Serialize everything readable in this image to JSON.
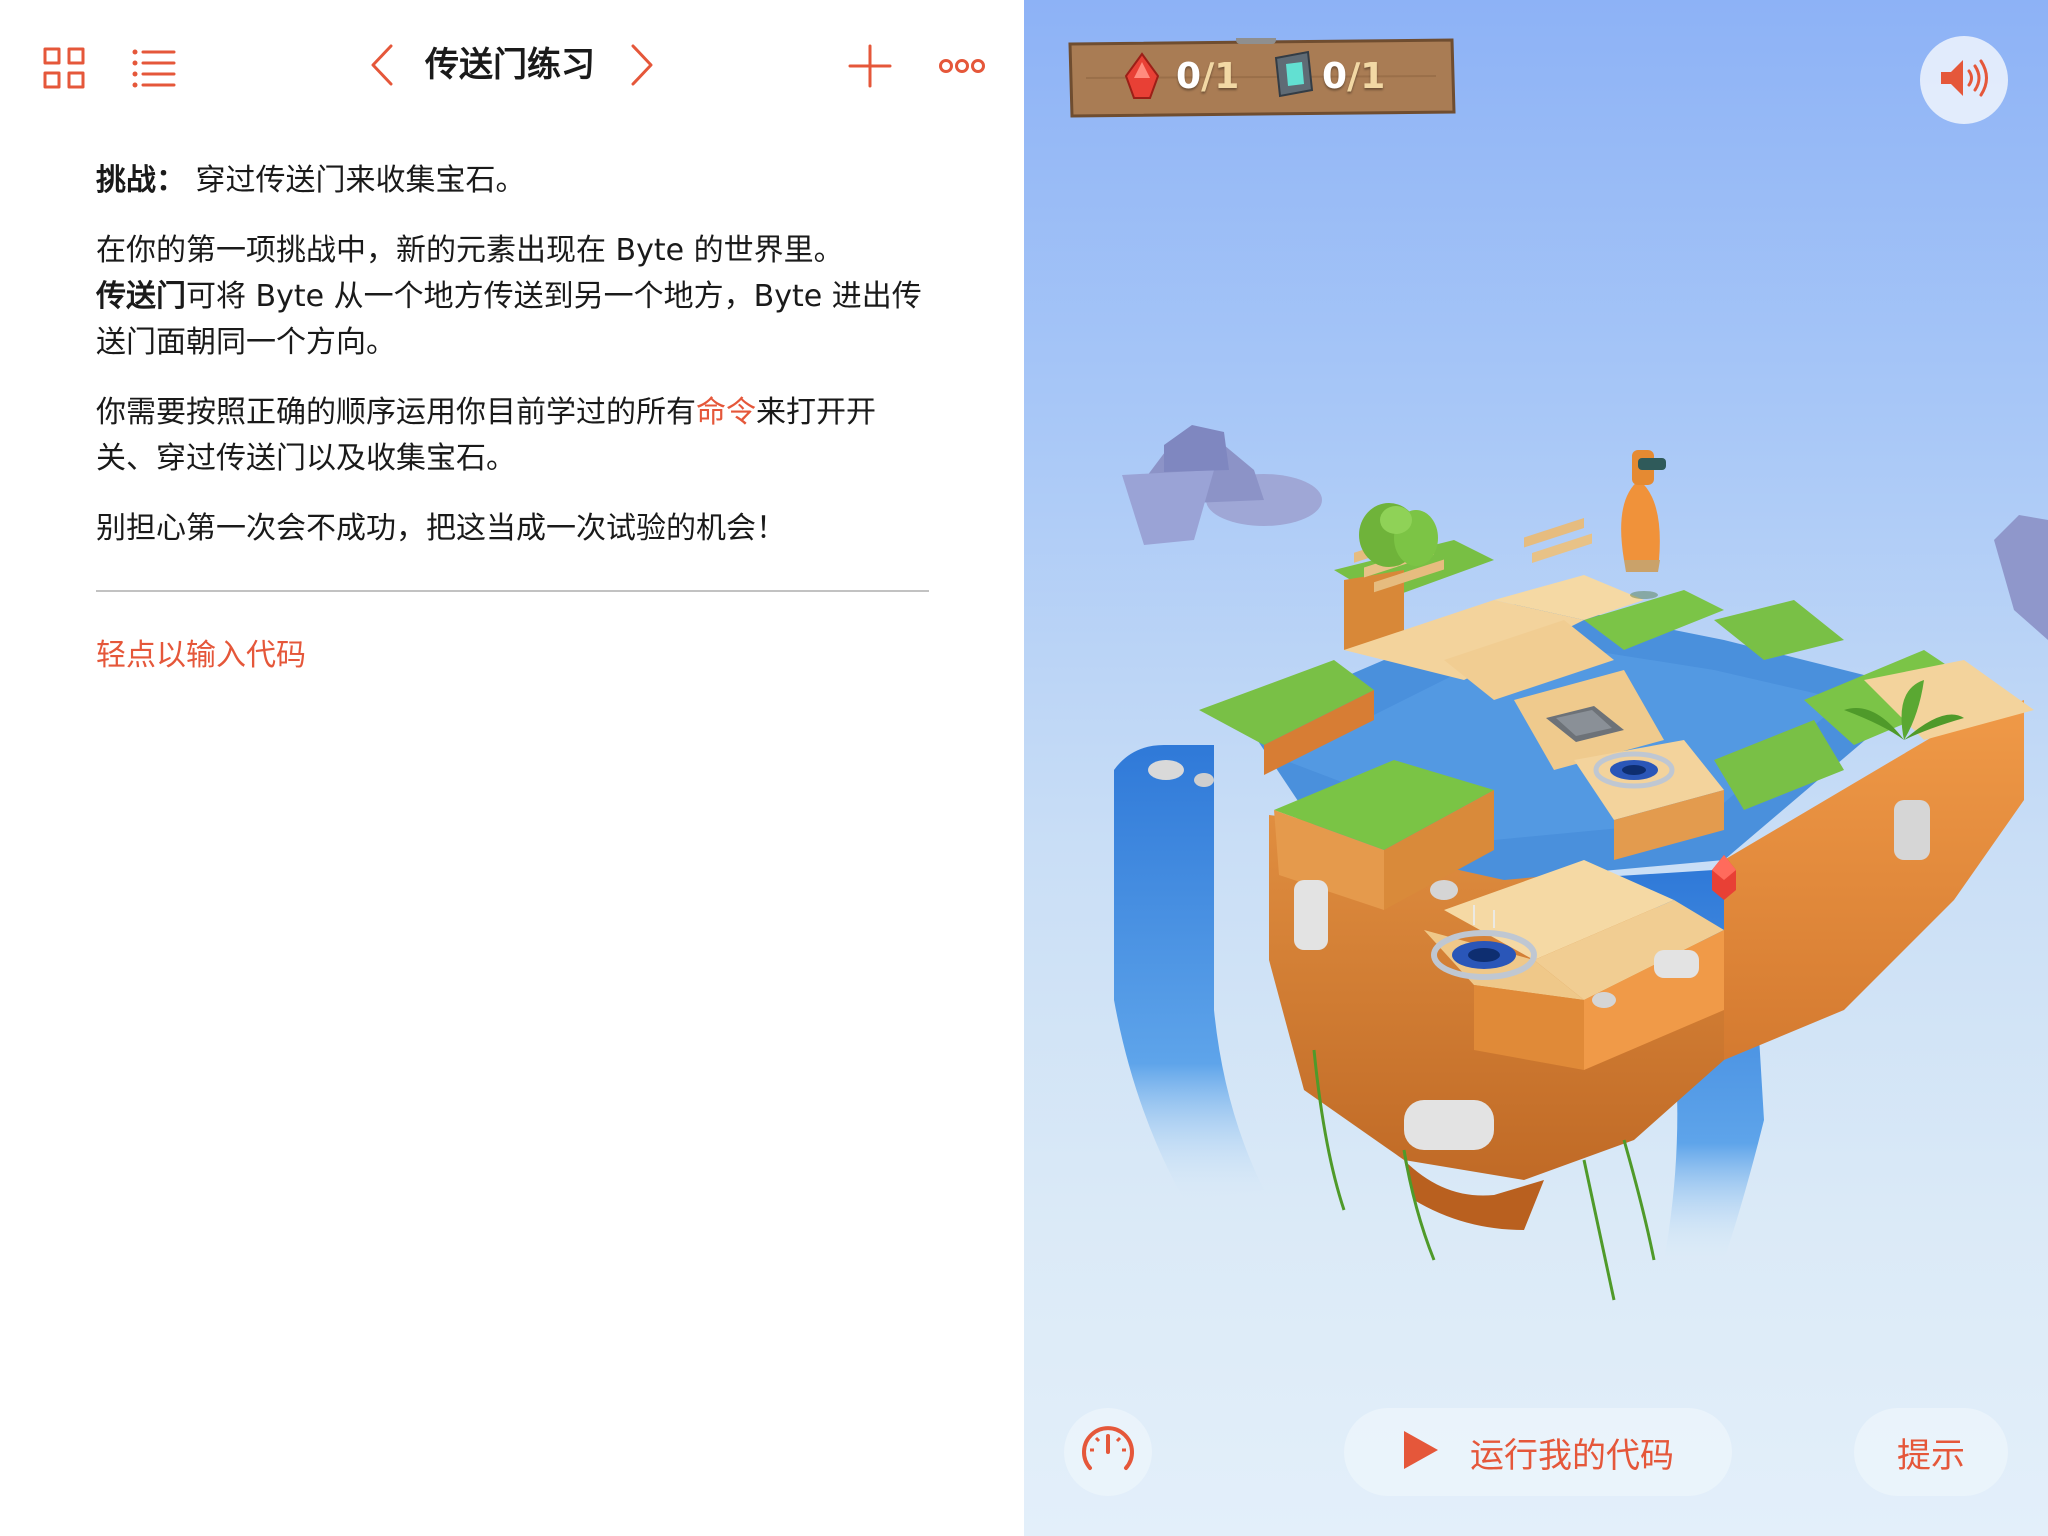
{
  "toolbar": {
    "title": "传送门练习",
    "icons": [
      "grid-icon",
      "list-icon",
      "chevron-left-icon",
      "chevron-right-icon",
      "plus-icon",
      "more-icon"
    ]
  },
  "content": {
    "challenge_label": "挑战：",
    "challenge_text": " 穿过传送门来收集宝石。",
    "para1": "在你的第一项挑战中，新的元素出现在  Byte  的世界里。",
    "para1b_bold": "传送门",
    "para1b_rest": "可将 Byte 从一个地方传送到另一个地方，Byte 进出传送门面朝同一个方向。",
    "para2_before": "你需要按照正确的顺序运用你目前学过的所有",
    "para2_link": "命令",
    "para2_after": "来打开开关、穿过传送门以及收集宝石。",
    "para3": "别担心第一次会不成功，把这当成一次试验的机会！",
    "tap_to_code": "轻点以输入代码"
  },
  "game": {
    "gems_collected": "0",
    "gems_total": "/1",
    "switches_on": "0",
    "switches_total": "/1",
    "run_label": "运行我的代码",
    "hint_label": "提示"
  },
  "colors": {
    "accent": "#e5573a",
    "sky_top": "#8db2f6",
    "sky_bottom": "#e3effa",
    "water": "#3f86d8",
    "grass": "#6fb83c",
    "sand": "#f0cf97",
    "dirt": "#dc8a3a"
  }
}
